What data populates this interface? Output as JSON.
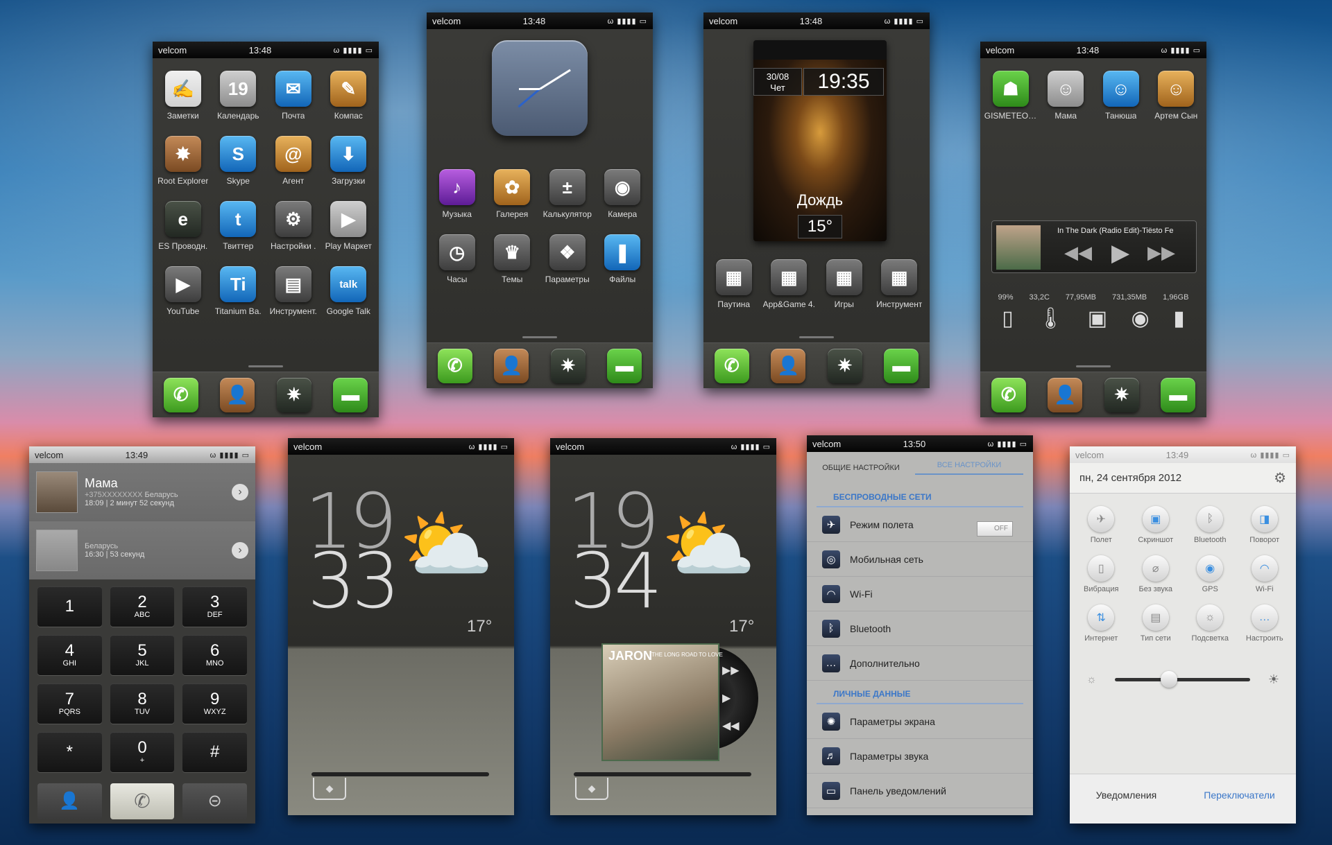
{
  "status": {
    "carrier": "velcom",
    "time1": "13:48",
    "time2": "13:49",
    "time3": "13:50",
    "signal": "ω ▮▮▮▮ ▭"
  },
  "screen1": {
    "apps": [
      {
        "label": "Заметки",
        "icon": "notes-icon",
        "glyph": "✍"
      },
      {
        "label": "Календарь",
        "icon": "calendar-icon",
        "glyph": "19"
      },
      {
        "label": "Почта",
        "icon": "mail-icon",
        "glyph": "✉"
      },
      {
        "label": "Компас",
        "icon": "compass-icon",
        "glyph": "✎"
      },
      {
        "label": "Root Explorer",
        "icon": "root-explorer-icon",
        "glyph": "✸"
      },
      {
        "label": "Skype",
        "icon": "skype-icon",
        "glyph": "S"
      },
      {
        "label": "Агент",
        "icon": "agent-icon",
        "glyph": "@"
      },
      {
        "label": "Загрузки",
        "icon": "downloads-icon",
        "glyph": "⬇"
      },
      {
        "label": "ES Проводн.",
        "icon": "es-explorer-icon",
        "glyph": "e"
      },
      {
        "label": "Твиттер",
        "icon": "twitter-icon",
        "glyph": "t"
      },
      {
        "label": "Настройки .",
        "icon": "settings-icon",
        "glyph": "⚙"
      },
      {
        "label": "Play Маркет",
        "icon": "play-market-icon",
        "glyph": "▶"
      },
      {
        "label": "YouTube",
        "icon": "youtube-icon",
        "glyph": "▶"
      },
      {
        "label": "Titanium Ba.",
        "icon": "titanium-icon",
        "glyph": "Ti"
      },
      {
        "label": "Инструмент.",
        "icon": "tools-icon",
        "glyph": "▤"
      },
      {
        "label": "Google Talk",
        "icon": "google-talk-icon",
        "glyph": "talk"
      }
    ]
  },
  "screen2": {
    "apps": [
      {
        "label": "Музыка",
        "icon": "music-icon",
        "glyph": "♪"
      },
      {
        "label": "Галерея",
        "icon": "gallery-icon",
        "glyph": "✿"
      },
      {
        "label": "Калькулятор",
        "icon": "calculator-icon",
        "glyph": "±"
      },
      {
        "label": "Камера",
        "icon": "camera-icon",
        "glyph": "◉"
      },
      {
        "label": "Часы",
        "icon": "clock-icon",
        "glyph": "◷"
      },
      {
        "label": "Темы",
        "icon": "themes-icon",
        "glyph": "♛"
      },
      {
        "label": "Параметры",
        "icon": "parameters-icon",
        "glyph": "❖"
      },
      {
        "label": "Файлы",
        "icon": "files-icon",
        "glyph": "❚"
      }
    ]
  },
  "screen3": {
    "date": "30/08",
    "day": "Чет",
    "time": "19:35",
    "weather": "Дождь",
    "temp": "15°",
    "apps": [
      {
        "label": "Паутина",
        "icon": "web-folder-icon",
        "glyph": "▦"
      },
      {
        "label": "App&Game 4.",
        "icon": "appgame-icon",
        "glyph": "▦"
      },
      {
        "label": "Игры",
        "icon": "games-folder-icon",
        "glyph": "▦"
      },
      {
        "label": "Инструмент",
        "icon": "tools-folder-icon",
        "glyph": "▦"
      }
    ]
  },
  "screen4": {
    "contacts": [
      "GISMETEO.B.",
      "Мама",
      "Танюша",
      "Артем Сын"
    ],
    "track": "In The Dark (Radio Edit)-Tiësto Fe",
    "stats": [
      "99%",
      "33,2C",
      "77,95MB",
      "731,35MB",
      "1,96GB"
    ]
  },
  "dialer": {
    "calls": [
      {
        "name": "Мама",
        "number": "+375XXXXXXXX",
        "country": "Беларусь",
        "meta": "18:09 | 2 минут 52 секунд"
      },
      {
        "name": "",
        "number": "",
        "country": "Беларусь",
        "meta": "16:30 | 53 секунд"
      }
    ],
    "keys": [
      {
        "d": "1",
        "l": ""
      },
      {
        "d": "2",
        "l": "ABC"
      },
      {
        "d": "3",
        "l": "DEF"
      },
      {
        "d": "4",
        "l": "GHI"
      },
      {
        "d": "5",
        "l": "JKL"
      },
      {
        "d": "6",
        "l": "MNO"
      },
      {
        "d": "7",
        "l": "PQRS"
      },
      {
        "d": "8",
        "l": "TUV"
      },
      {
        "d": "9",
        "l": "WXYZ"
      },
      {
        "d": "*",
        "l": ""
      },
      {
        "d": "0",
        "l": "+"
      },
      {
        "d": "#",
        "l": ""
      }
    ]
  },
  "lock1": {
    "hour": "19",
    "min": "33",
    "temp": "17°"
  },
  "lock2": {
    "hour": "19",
    "min": "34",
    "temp": "17°",
    "album_artist": "JARON",
    "album_title": "THE LONG ROAD TO LOVE"
  },
  "settings": {
    "tab1": "ОБЩИЕ НАСТРОЙКИ",
    "tab2": "ВСЕ НАСТРОЙКИ",
    "sec1": "БЕСПРОВОДНЫЕ СЕТИ",
    "sec2": "ЛИЧНЫЕ ДАННЫЕ",
    "toggle": "OFF",
    "wireless": [
      {
        "label": "Режим полета",
        "icon": "airplane-icon",
        "glyph": "✈"
      },
      {
        "label": "Мобильная сеть",
        "icon": "mobile-network-icon",
        "glyph": "◎"
      },
      {
        "label": "Wi-Fi",
        "icon": "wifi-icon",
        "glyph": "◠"
      },
      {
        "label": "Bluetooth",
        "icon": "bluetooth-icon",
        "glyph": "ᛒ"
      },
      {
        "label": "Дополнительно",
        "icon": "more-icon",
        "glyph": "…"
      }
    ],
    "personal": [
      {
        "label": "Параметры экрана",
        "icon": "display-icon",
        "glyph": "✺"
      },
      {
        "label": "Параметры звука",
        "icon": "sound-icon",
        "glyph": "♬"
      },
      {
        "label": "Панель уведомлений",
        "icon": "notification-panel-icon",
        "glyph": "▭"
      }
    ]
  },
  "quick": {
    "date": "пн, 24 сентября 2012",
    "tab1": "Уведомления",
    "tab2": "Переключатели",
    "toggles": [
      {
        "label": "Полет",
        "icon": "airplane-icon",
        "glyph": "✈",
        "on": false
      },
      {
        "label": "Скриншот",
        "icon": "screenshot-icon",
        "glyph": "▣",
        "on": true
      },
      {
        "label": "Bluetooth",
        "icon": "bluetooth-icon",
        "glyph": "ᛒ",
        "on": false
      },
      {
        "label": "Поворот",
        "icon": "rotate-icon",
        "glyph": "◨",
        "on": true
      },
      {
        "label": "Вибрация",
        "icon": "vibration-icon",
        "glyph": "▯",
        "on": false
      },
      {
        "label": "Без звука",
        "icon": "silent-icon",
        "glyph": "⌀",
        "on": false
      },
      {
        "label": "GPS",
        "icon": "gps-icon",
        "glyph": "◉",
        "on": true
      },
      {
        "label": "Wi-Fi",
        "icon": "wifi-icon",
        "glyph": "◠",
        "on": true
      },
      {
        "label": "Интернет",
        "icon": "internet-icon",
        "glyph": "⇅",
        "on": true
      },
      {
        "label": "Тип сети",
        "icon": "network-type-icon",
        "glyph": "▤",
        "on": false
      },
      {
        "label": "Подсветка",
        "icon": "backlight-icon",
        "glyph": "☼",
        "on": false
      },
      {
        "label": "Настроить",
        "icon": "customize-icon",
        "glyph": "…",
        "on": true
      }
    ],
    "brightness": 0.4
  }
}
